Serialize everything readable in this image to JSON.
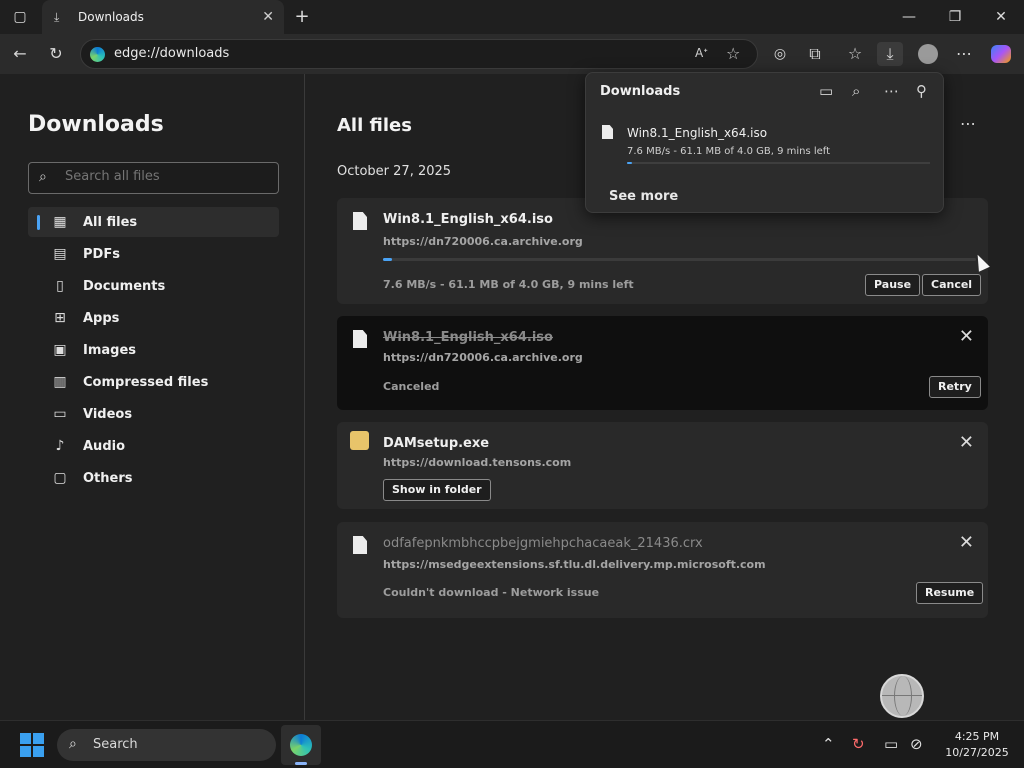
{
  "tab": {
    "title": "Downloads"
  },
  "address": {
    "url": "edge://downloads"
  },
  "sidebar": {
    "title": "Downloads",
    "search_placeholder": "Search all files",
    "items": [
      {
        "label": "All files",
        "icon": "grid-icon",
        "active": true
      },
      {
        "label": "PDFs",
        "icon": "pdf-icon"
      },
      {
        "label": "Documents",
        "icon": "document-icon"
      },
      {
        "label": "Apps",
        "icon": "apps-icon"
      },
      {
        "label": "Images",
        "icon": "image-icon"
      },
      {
        "label": "Compressed files",
        "icon": "archive-icon"
      },
      {
        "label": "Videos",
        "icon": "video-icon"
      },
      {
        "label": "Audio",
        "icon": "audio-icon"
      },
      {
        "label": "Others",
        "icon": "other-file-icon"
      }
    ]
  },
  "main": {
    "title": "All files",
    "date": "October 27, 2025",
    "downloads": [
      {
        "name": "Win8.1_English_x64.iso",
        "url": "https://dn720006.ca.archive.org",
        "status": "7.6 MB/s - 61.1 MB of 4.0 GB, 9 mins left",
        "progress": 0.015,
        "buttons": [
          "Pause",
          "Cancel"
        ]
      },
      {
        "name": "Win8.1_English_x64.iso",
        "url": "https://dn720006.ca.archive.org",
        "status": "Canceled",
        "buttons": [
          "Retry"
        ]
      },
      {
        "name": "DAMsetup.exe",
        "url": "https://download.tensons.com",
        "buttons": [
          "Show in folder"
        ]
      },
      {
        "name": "odfafepnkmbhccpbejgmiehpchacaeak_21436.crx",
        "url": "https://msedgeextensions.sf.tlu.dl.delivery.mp.microsoft.com",
        "status": "Couldn't download - Network issue",
        "buttons": [
          "Resume"
        ]
      }
    ]
  },
  "flyout": {
    "title": "Downloads",
    "item": {
      "name": "Win8.1_English_x64.iso",
      "status": "7.6 MB/s - 61.1 MB of 4.0 GB, 9 mins left",
      "progress": 0.015
    },
    "see_more": "See more"
  },
  "taskbar": {
    "search_label": "Search",
    "time": "4:25 PM",
    "date": "10/27/2025"
  },
  "colors": {
    "accent": "#4aa3f5",
    "background": "#202020"
  }
}
